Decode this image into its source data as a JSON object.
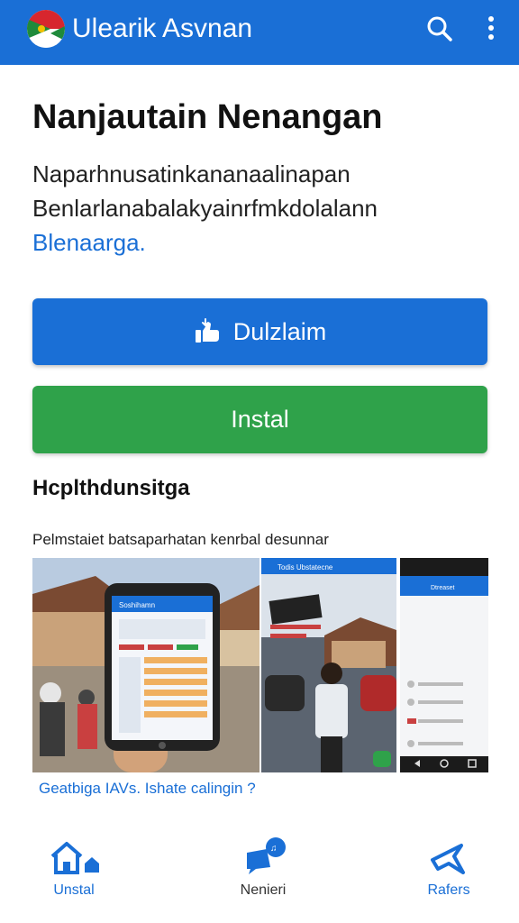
{
  "appbar": {
    "title": "Ulearik Asvnan",
    "logo_icon": "flag-circle-logo",
    "actions": [
      "search-icon",
      "more-vert-icon"
    ]
  },
  "headline": "Nanjautain Nenangan",
  "description": {
    "line1": "Naparhnusatinkananaalinapan",
    "line2": "Benlarlanabalakyainrfmkdolalann",
    "link": "Blenaarga."
  },
  "buttons": {
    "download": {
      "label": "Dulzlaim",
      "icon": "download-hand-icon"
    },
    "install": {
      "label": "Instal"
    }
  },
  "section_title": "Hcplthdunsitga",
  "caption": "Pelmstaiet batsaparhatan kenrbal desunnar",
  "screenshots": {
    "shot1_header": "Soshihamn",
    "shot2_header": "Todis Ubstatecne",
    "shot3_header": "Dtreaset"
  },
  "more_link": "Geatbiga IAVs. Ishate calingin ?",
  "bottom_nav": [
    {
      "label": "Unstal",
      "icon": "home-icon"
    },
    {
      "label": "Nenieri",
      "icon": "chat-notification-icon"
    },
    {
      "label": "Rafers",
      "icon": "send-icon"
    }
  ],
  "colors": {
    "primary": "#1a6fd6",
    "success": "#2fa24a"
  }
}
